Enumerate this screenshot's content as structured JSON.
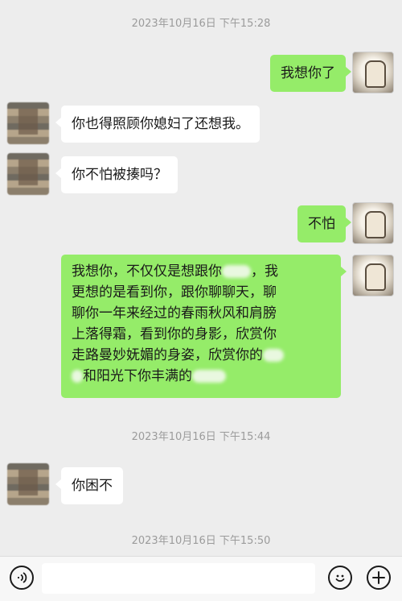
{
  "timestamps": [
    "2023年10月16日 下午15:28",
    "2023年10月16日 下午15:44",
    "2023年10月16日 下午15:50"
  ],
  "messages": [
    {
      "side": "right",
      "text": "我想你了"
    },
    {
      "side": "left",
      "text": "你也得照顾你媳妇了还想我。"
    },
    {
      "side": "left",
      "text": "你不怕被揍吗？"
    },
    {
      "side": "right",
      "text": "不怕"
    },
    {
      "side": "right",
      "lines": [
        "我想你，不仅仅是想跟你",
        "，我",
        "更想的是看到你，跟你聊聊天，聊",
        "聊你一年来经过的春雨秋风和肩膀",
        "上落得霜，看到你的身影，欣赏你",
        "走路曼妙妩媚的身姿，欣赏你的",
        "和阳光下你丰满的"
      ]
    },
    {
      "side": "left",
      "text": "你困不"
    }
  ],
  "bottom_bar": {
    "voice_icon": "voice-icon",
    "emoji_icon": "emoji-icon",
    "plus_icon": "plus-icon"
  },
  "colors": {
    "background": "#ededed",
    "sent_bubble": "#95ec69",
    "received_bubble": "#ffffff",
    "timestamp": "#9b9b9b"
  }
}
